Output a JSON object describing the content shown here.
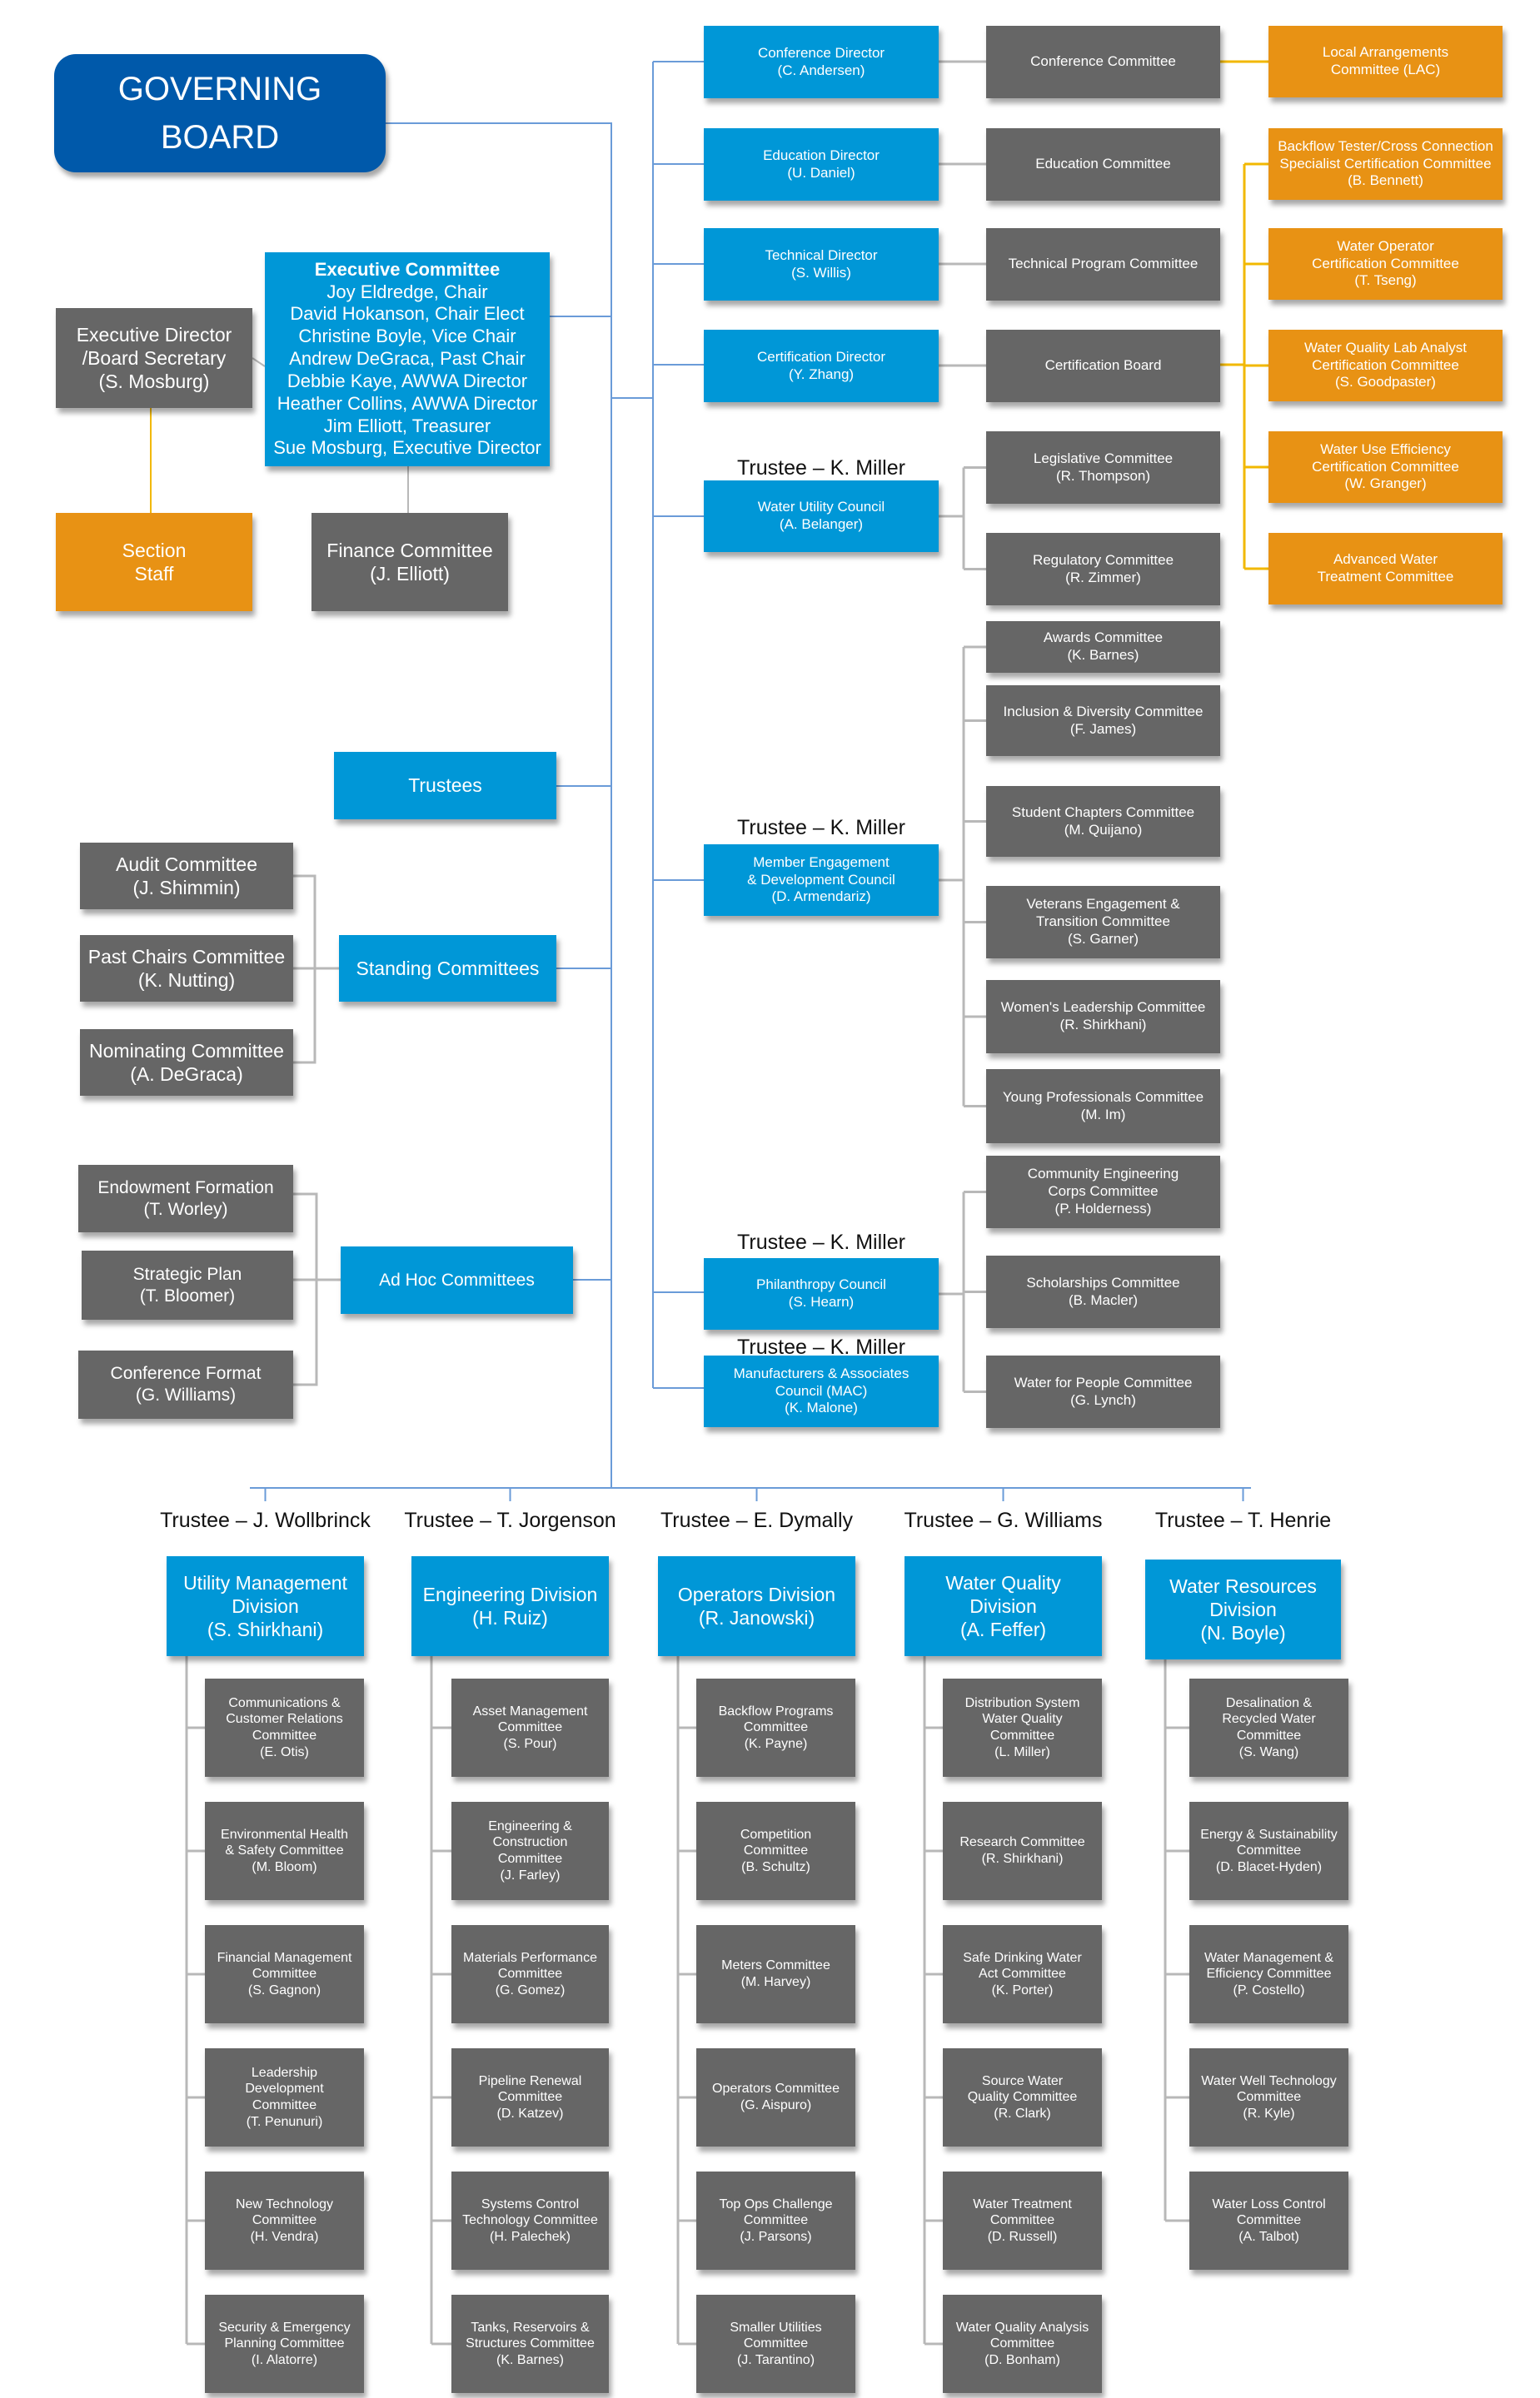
{
  "colors": {
    "board": "#0059aa",
    "primary": "#0097d7",
    "committee": "#666666",
    "certification": "#e89214",
    "board_line": "#6a9bd8",
    "committee_line": "#b8b8b8",
    "staff_line": "#f2b800"
  },
  "governing_board": {
    "lines": [
      "GOVERNING",
      "BOARD"
    ]
  },
  "executive_director": {
    "lines": [
      "Executive Director",
      "/Board Secretary",
      "(S. Mosburg)"
    ]
  },
  "executive_committee": {
    "title": "Executive Committee",
    "members": [
      "Joy Eldredge, Chair",
      "David Hokanson, Chair Elect",
      "Christine Boyle, Vice Chair",
      "Andrew DeGraca, Past Chair",
      "Debbie Kaye, AWWA Director",
      "Heather Collins, AWWA Director",
      "Jim Elliott, Treasurer",
      "Sue Mosburg, Executive Director"
    ]
  },
  "section_staff": {
    "lines": [
      "Section",
      "Staff"
    ]
  },
  "finance_committee": {
    "lines": [
      "Finance Committee",
      "(J. Elliott)"
    ]
  },
  "trustees": {
    "lines": [
      "Trustees"
    ]
  },
  "standing_committees": {
    "title": {
      "lines": [
        "Standing Committees"
      ]
    },
    "items": [
      {
        "lines": [
          "Audit Committee",
          "(J. Shimmin)"
        ]
      },
      {
        "lines": [
          "Past Chairs Committee",
          "(K. Nutting)"
        ]
      },
      {
        "lines": [
          "Nominating Committee",
          "(A. DeGraca)"
        ]
      }
    ]
  },
  "ad_hoc_committees": {
    "title": {
      "lines": [
        "Ad Hoc Committees"
      ]
    },
    "items": [
      {
        "lines": [
          "Endowment Formation",
          "(T. Worley)"
        ]
      },
      {
        "lines": [
          "Strategic Plan",
          "(T. Bloomer)"
        ]
      },
      {
        "lines": [
          "Conference Format",
          "(G. Williams)"
        ]
      }
    ]
  },
  "directors": [
    {
      "lines": [
        "Conference Director",
        "(C. Andersen)"
      ],
      "committee": {
        "lines": [
          "Conference Committee"
        ]
      }
    },
    {
      "lines": [
        "Education Director",
        "(U. Daniel)"
      ],
      "committee": {
        "lines": [
          "Education Committee"
        ]
      }
    },
    {
      "lines": [
        "Technical Director",
        "(S. Willis)"
      ],
      "committee": {
        "lines": [
          "Technical Program Committee"
        ]
      }
    },
    {
      "lines": [
        "Certification Director",
        "(Y. Zhang)"
      ],
      "committee": {
        "lines": [
          "Certification Board"
        ]
      }
    }
  ],
  "certification_committees": [
    {
      "lines": [
        "Local Arrangements",
        "Committee (LAC)"
      ]
    },
    {
      "lines": [
        "Backflow Tester/Cross Connection",
        "Specialist Certification Committee",
        "(B. Bennett)"
      ]
    },
    {
      "lines": [
        "Water Operator",
        "Certification Committee",
        "(T. Tseng)"
      ]
    },
    {
      "lines": [
        "Water Quality Lab Analyst",
        "Certification Committee",
        "(S. Goodpaster)"
      ]
    },
    {
      "lines": [
        "Water Use Efficiency",
        "Certification Committee",
        "(W. Granger)"
      ]
    },
    {
      "lines": [
        "Advanced Water",
        "Treatment Committee"
      ]
    }
  ],
  "councils": [
    {
      "trustee": "Trustee – K. Miller",
      "lines": [
        "Water Utility Council",
        "(A. Belanger)"
      ],
      "committees": [
        {
          "lines": [
            "Legislative Committee",
            "(R. Thompson)"
          ]
        },
        {
          "lines": [
            "Regulatory Committee",
            "(R. Zimmer)"
          ]
        }
      ]
    },
    {
      "trustee": "Trustee – K. Miller",
      "lines": [
        "Member Engagement",
        "& Development Council",
        "(D. Armendariz)"
      ],
      "committees": [
        {
          "lines": [
            "Awards Committee",
            "(K. Barnes)"
          ]
        },
        {
          "lines": [
            "Inclusion & Diversity Committee",
            "(F. James)"
          ]
        },
        {
          "lines": [
            "Student Chapters Committee",
            "(M. Quijano)"
          ]
        },
        {
          "lines": [
            "Veterans Engagement &",
            "Transition Committee",
            "(S. Garner)"
          ]
        },
        {
          "lines": [
            "Women's Leadership Committee",
            "(R. Shirkhani)"
          ]
        },
        {
          "lines": [
            "Young Professionals Committee",
            "(M. Im)"
          ]
        }
      ]
    },
    {
      "trustee": "Trustee – K. Miller",
      "lines": [
        "Philanthropy Council",
        "(S. Hearn)"
      ],
      "committees": [
        {
          "lines": [
            "Community Engineering",
            "Corps Committee",
            "(P. Holderness)"
          ]
        },
        {
          "lines": [
            "Scholarships Committee",
            "(B. Macler)"
          ]
        },
        {
          "lines": [
            "Water for People Committee",
            "(G. Lynch)"
          ]
        }
      ]
    },
    {
      "trustee": "Trustee – K. Miller",
      "lines": [
        "Manufacturers & Associates",
        "Council (MAC)",
        "(K. Malone)"
      ],
      "committees": []
    }
  ],
  "divisions": [
    {
      "trustee": "Trustee – J. Wollbrinck",
      "lines": [
        "Utility Management",
        "Division",
        "(S. Shirkhani)"
      ],
      "committees": [
        {
          "lines": [
            "Communications &",
            "Customer Relations",
            "Committee",
            "(E. Otis)"
          ]
        },
        {
          "lines": [
            "Environmental Health",
            "& Safety Committee",
            "(M. Bloom)"
          ]
        },
        {
          "lines": [
            "Financial Management",
            "Committee",
            "(S. Gagnon)"
          ]
        },
        {
          "lines": [
            "Leadership",
            "Development",
            "Committee",
            "(T. Penunuri)"
          ]
        },
        {
          "lines": [
            "New Technology",
            "Committee",
            "(H. Vendra)"
          ]
        },
        {
          "lines": [
            "Security & Emergency",
            "Planning Committee",
            "(I. Alatorre)"
          ]
        }
      ]
    },
    {
      "trustee": "Trustee – T. Jorgenson",
      "lines": [
        "Engineering Division",
        "(H. Ruiz)"
      ],
      "committees": [
        {
          "lines": [
            "Asset Management",
            "Committee",
            "(S. Pour)"
          ]
        },
        {
          "lines": [
            "Engineering &",
            "Construction",
            "Committee",
            "(J. Farley)"
          ]
        },
        {
          "lines": [
            "Materials Performance",
            "Committee",
            "(G. Gomez)"
          ]
        },
        {
          "lines": [
            "Pipeline Renewal",
            "Committee",
            "(D. Katzev)"
          ]
        },
        {
          "lines": [
            "Systems Control",
            "Technology Committee",
            "(H. Palechek)"
          ]
        },
        {
          "lines": [
            "Tanks, Reservoirs &",
            "Structures Committee",
            "(K. Barnes)"
          ]
        }
      ]
    },
    {
      "trustee": "Trustee – E. Dymally",
      "lines": [
        "Operators Division",
        "(R. Janowski)"
      ],
      "committees": [
        {
          "lines": [
            "Backflow Programs",
            "Committee",
            "(K. Payne)"
          ]
        },
        {
          "lines": [
            "Competition",
            "Committee",
            "(B. Schultz)"
          ]
        },
        {
          "lines": [
            "Meters Committee",
            "(M. Harvey)"
          ]
        },
        {
          "lines": [
            "Operators Committee",
            "(G. Aispuro)"
          ]
        },
        {
          "lines": [
            "Top Ops Challenge",
            "Committee",
            "(J. Parsons)"
          ]
        },
        {
          "lines": [
            "Smaller Utilities",
            "Committee",
            "(J. Tarantino)"
          ]
        }
      ]
    },
    {
      "trustee": "Trustee – G. Williams",
      "lines": [
        "Water Quality",
        "Division",
        "(A. Feffer)"
      ],
      "committees": [
        {
          "lines": [
            "Distribution System",
            "Water Quality",
            "Committee",
            "(L. Miller)"
          ]
        },
        {
          "lines": [
            "Research Committee",
            "(R. Shirkhani)"
          ]
        },
        {
          "lines": [
            "Safe Drinking Water",
            "Act Committee",
            "(K. Porter)"
          ]
        },
        {
          "lines": [
            "Source Water",
            "Quality Committee",
            "(R. Clark)"
          ]
        },
        {
          "lines": [
            "Water Treatment",
            "Committee",
            "(D. Russell)"
          ]
        },
        {
          "lines": [
            "Water Quality Analysis",
            "Committee",
            "(D. Bonham)"
          ]
        }
      ]
    },
    {
      "trustee": "Trustee – T. Henrie",
      "lines": [
        "Water Resources",
        "Division",
        "(N. Boyle)"
      ],
      "committees": [
        {
          "lines": [
            "Desalination &",
            "Recycled Water",
            "Committee",
            "(S. Wang)"
          ]
        },
        {
          "lines": [
            "Energy & Sustainability",
            "Committee",
            "(D. Blacet-Hyden)"
          ]
        },
        {
          "lines": [
            "Water Management &",
            "Efficiency Committee",
            "(P. Costello)"
          ]
        },
        {
          "lines": [
            "Water Well Technology",
            "Committee",
            "(R. Kyle)"
          ]
        },
        {
          "lines": [
            "Water Loss Control",
            "Committee",
            "(A. Talbot)"
          ]
        }
      ]
    }
  ]
}
